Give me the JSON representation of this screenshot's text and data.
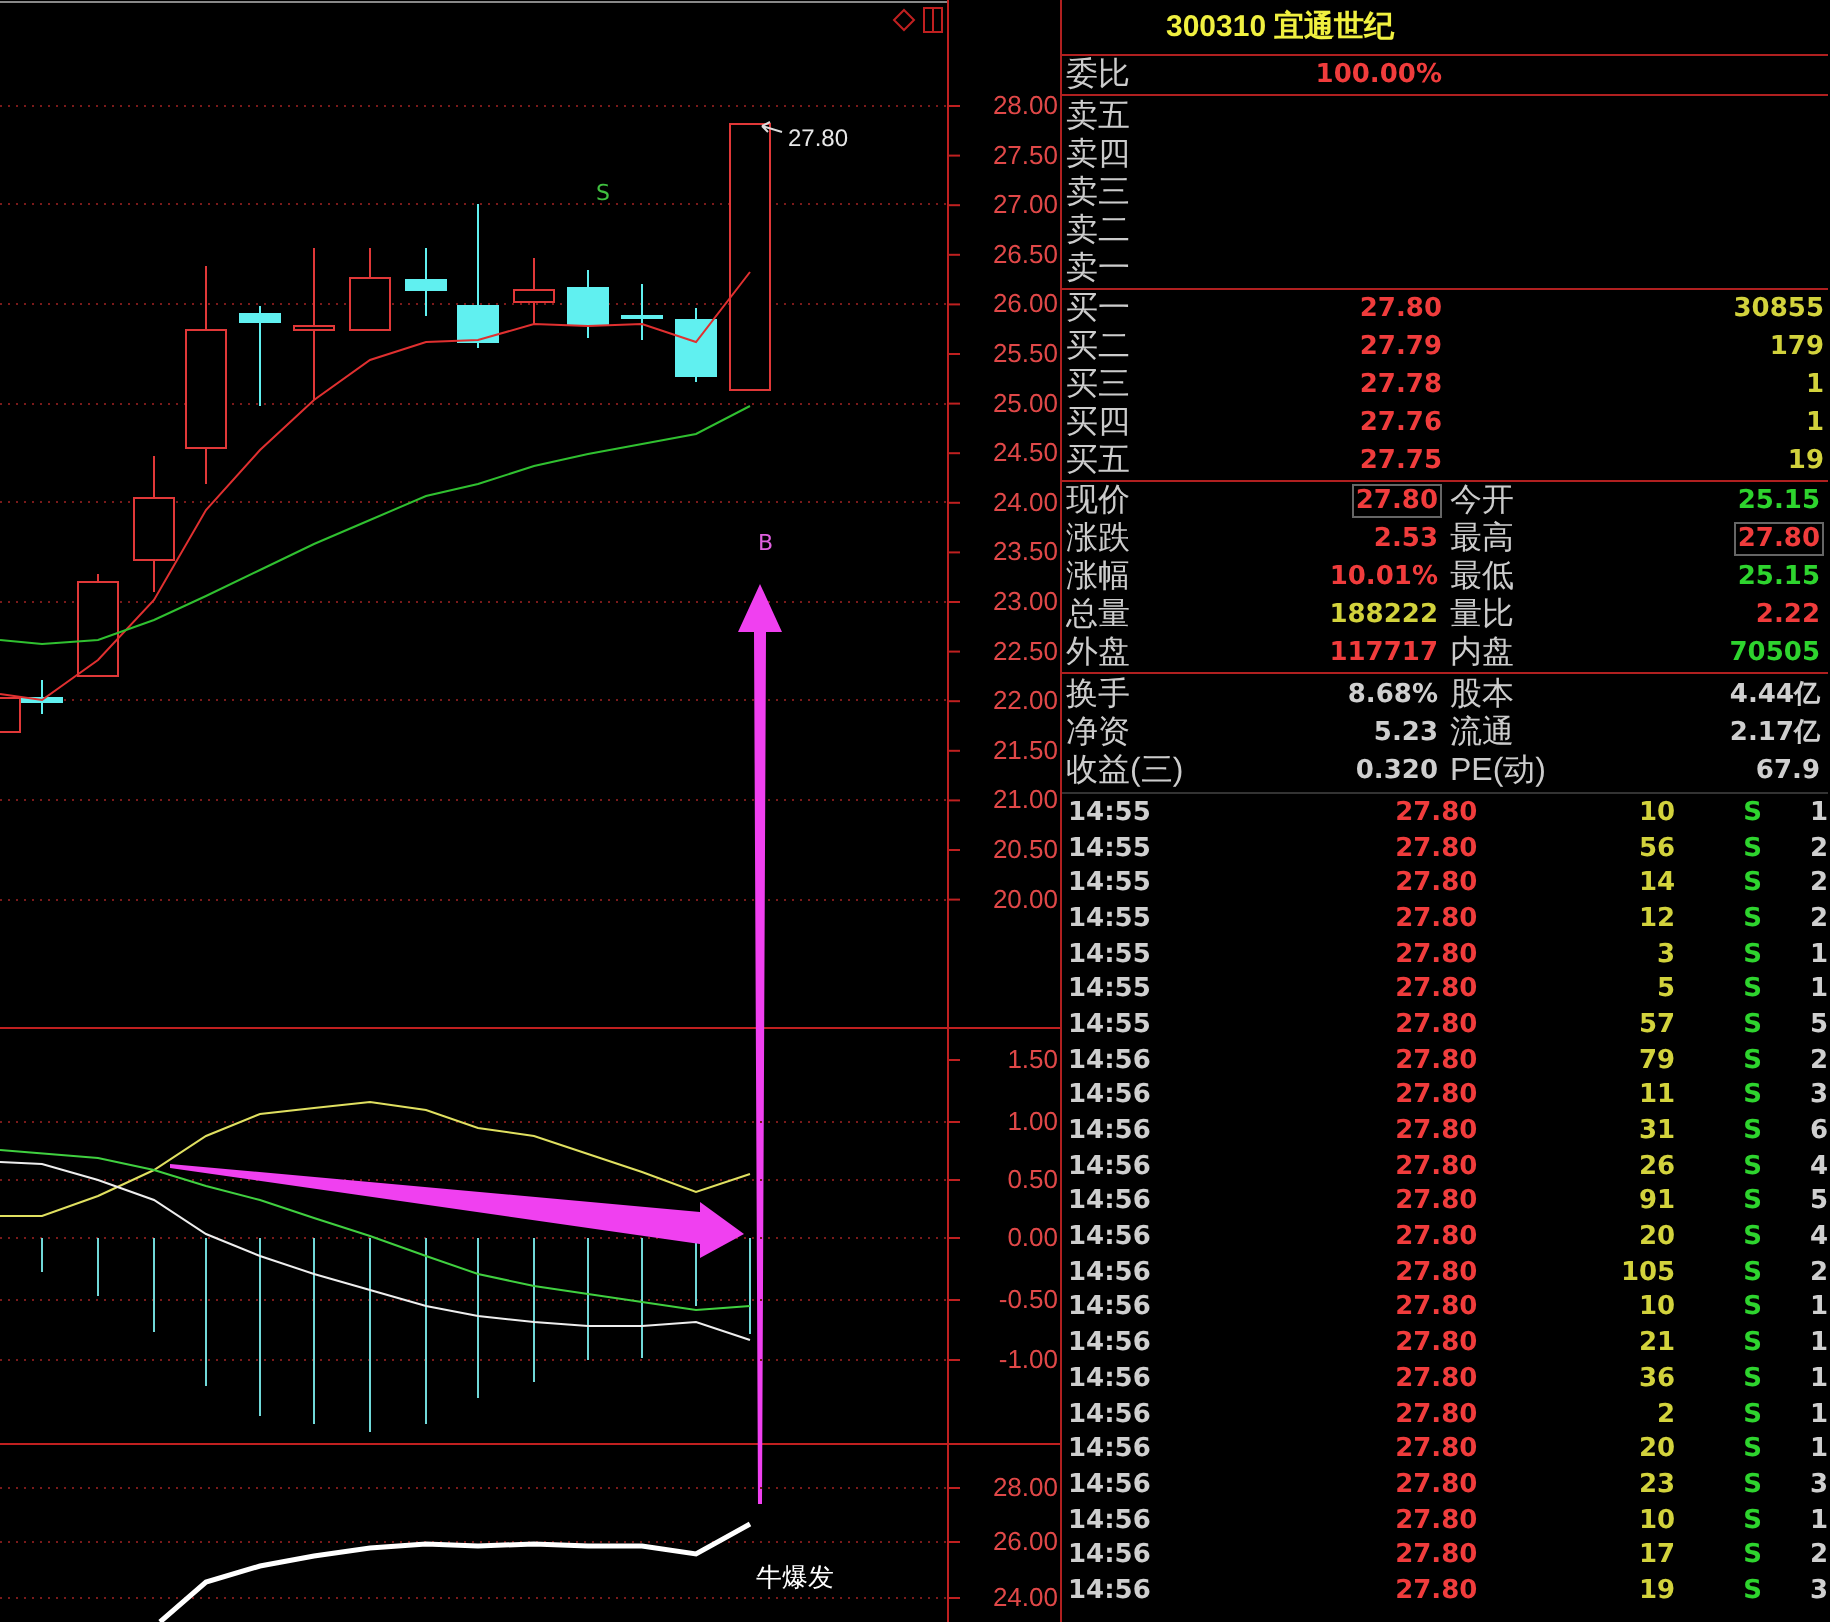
{
  "price_chart": {
    "axis_labels": [
      "28.00",
      "27.50",
      "27.00",
      "26.50",
      "26.00",
      "25.50",
      "25.00",
      "24.50",
      "24.00",
      "23.50",
      "23.00",
      "22.50",
      "22.00",
      "21.50",
      "21.00",
      "20.50",
      "20.00"
    ],
    "last_price_label": "27.80",
    "sell_signal": "S",
    "buy_signal": "B"
  },
  "indicator_chart": {
    "axis_labels": [
      "1.50",
      "1.00",
      "0.50",
      "0.00",
      "-0.50",
      "-1.00"
    ]
  },
  "bottom_chart": {
    "axis_labels": [
      "28.00",
      "26.00",
      "24.00"
    ],
    "signal_label": "牛爆发"
  },
  "quote": {
    "title": "300310 宜通世纪",
    "ratio": {
      "label": "委比",
      "value": "100.00%"
    },
    "asks": [
      {
        "label": "卖五"
      },
      {
        "label": "卖四"
      },
      {
        "label": "卖三"
      },
      {
        "label": "卖二"
      },
      {
        "label": "卖一"
      }
    ],
    "bids": [
      {
        "label": "买一",
        "price": "27.80",
        "volume": "30855"
      },
      {
        "label": "买二",
        "price": "27.79",
        "volume": "179"
      },
      {
        "label": "买三",
        "price": "27.78",
        "volume": "1"
      },
      {
        "label": "买四",
        "price": "27.76",
        "volume": "1"
      },
      {
        "label": "买五",
        "price": "27.75",
        "volume": "19"
      }
    ],
    "stats": [
      {
        "left": {
          "label": "现价",
          "value": "27.80",
          "color": "#f03c3c",
          "boxed": true
        },
        "right": {
          "label": "今开",
          "value": "25.15",
          "color": "#2ed42e",
          "boxed": false
        }
      },
      {
        "left": {
          "label": "涨跌",
          "value": "2.53",
          "color": "#f03c3c",
          "boxed": false
        },
        "right": {
          "label": "最高",
          "value": "27.80",
          "color": "#f03c3c",
          "boxed": true
        }
      },
      {
        "left": {
          "label": "涨幅",
          "value": "10.01%",
          "color": "#f03c3c",
          "boxed": false
        },
        "right": {
          "label": "最低",
          "value": "25.15",
          "color": "#2ed42e",
          "boxed": false
        }
      },
      {
        "left": {
          "label": "总量",
          "value": "188222",
          "color": "#d2d23c",
          "boxed": false
        },
        "right": {
          "label": "量比",
          "value": "2.22",
          "color": "#f03c3c",
          "boxed": false
        }
      },
      {
        "left": {
          "label": "外盘",
          "value": "117717",
          "color": "#f03c3c",
          "boxed": false
        },
        "right": {
          "label": "内盘",
          "value": "70505",
          "color": "#2ed42e",
          "boxed": false
        }
      }
    ],
    "fundamentals": [
      {
        "left": {
          "label": "换手",
          "value": "8.68%"
        },
        "right": {
          "label": "股本",
          "value": "4.44亿"
        }
      },
      {
        "left": {
          "label": "净资",
          "value": "5.23"
        },
        "right": {
          "label": "流通",
          "value": "2.17亿"
        }
      },
      {
        "left": {
          "label": "收益(三)",
          "value": "0.320"
        },
        "right": {
          "label": "PE(动)",
          "value": "67.9"
        }
      }
    ]
  },
  "trades": [
    {
      "time": "14:55",
      "price": "27.80",
      "volume": "10",
      "side": "S",
      "count": "1"
    },
    {
      "time": "14:55",
      "price": "27.80",
      "volume": "56",
      "side": "S",
      "count": "2"
    },
    {
      "time": "14:55",
      "price": "27.80",
      "volume": "14",
      "side": "S",
      "count": "2"
    },
    {
      "time": "14:55",
      "price": "27.80",
      "volume": "12",
      "side": "S",
      "count": "2"
    },
    {
      "time": "14:55",
      "price": "27.80",
      "volume": "3",
      "side": "S",
      "count": "1"
    },
    {
      "time": "14:55",
      "price": "27.80",
      "volume": "5",
      "side": "S",
      "count": "1"
    },
    {
      "time": "14:55",
      "price": "27.80",
      "volume": "57",
      "side": "S",
      "count": "5"
    },
    {
      "time": "14:56",
      "price": "27.80",
      "volume": "79",
      "side": "S",
      "count": "2"
    },
    {
      "time": "14:56",
      "price": "27.80",
      "volume": "11",
      "side": "S",
      "count": "3"
    },
    {
      "time": "14:56",
      "price": "27.80",
      "volume": "31",
      "side": "S",
      "count": "6"
    },
    {
      "time": "14:56",
      "price": "27.80",
      "volume": "26",
      "side": "S",
      "count": "4"
    },
    {
      "time": "14:56",
      "price": "27.80",
      "volume": "91",
      "side": "S",
      "count": "5"
    },
    {
      "time": "14:56",
      "price": "27.80",
      "volume": "20",
      "side": "S",
      "count": "4"
    },
    {
      "time": "14:56",
      "price": "27.80",
      "volume": "105",
      "side": "S",
      "count": "2"
    },
    {
      "time": "14:56",
      "price": "27.80",
      "volume": "10",
      "side": "S",
      "count": "1"
    },
    {
      "time": "14:56",
      "price": "27.80",
      "volume": "21",
      "side": "S",
      "count": "1"
    },
    {
      "time": "14:56",
      "price": "27.80",
      "volume": "36",
      "side": "S",
      "count": "1"
    },
    {
      "time": "14:56",
      "price": "27.80",
      "volume": "2",
      "side": "S",
      "count": "1"
    },
    {
      "time": "14:56",
      "price": "27.80",
      "volume": "20",
      "side": "S",
      "count": "1"
    },
    {
      "time": "14:56",
      "price": "27.80",
      "volume": "23",
      "side": "S",
      "count": "3"
    },
    {
      "time": "14:56",
      "price": "27.80",
      "volume": "10",
      "side": "S",
      "count": "1"
    },
    {
      "time": "14:56",
      "price": "27.80",
      "volume": "17",
      "side": "S",
      "count": "2"
    },
    {
      "time": "14:56",
      "price": "27.80",
      "volume": "19",
      "side": "S",
      "count": "3"
    }
  ]
}
